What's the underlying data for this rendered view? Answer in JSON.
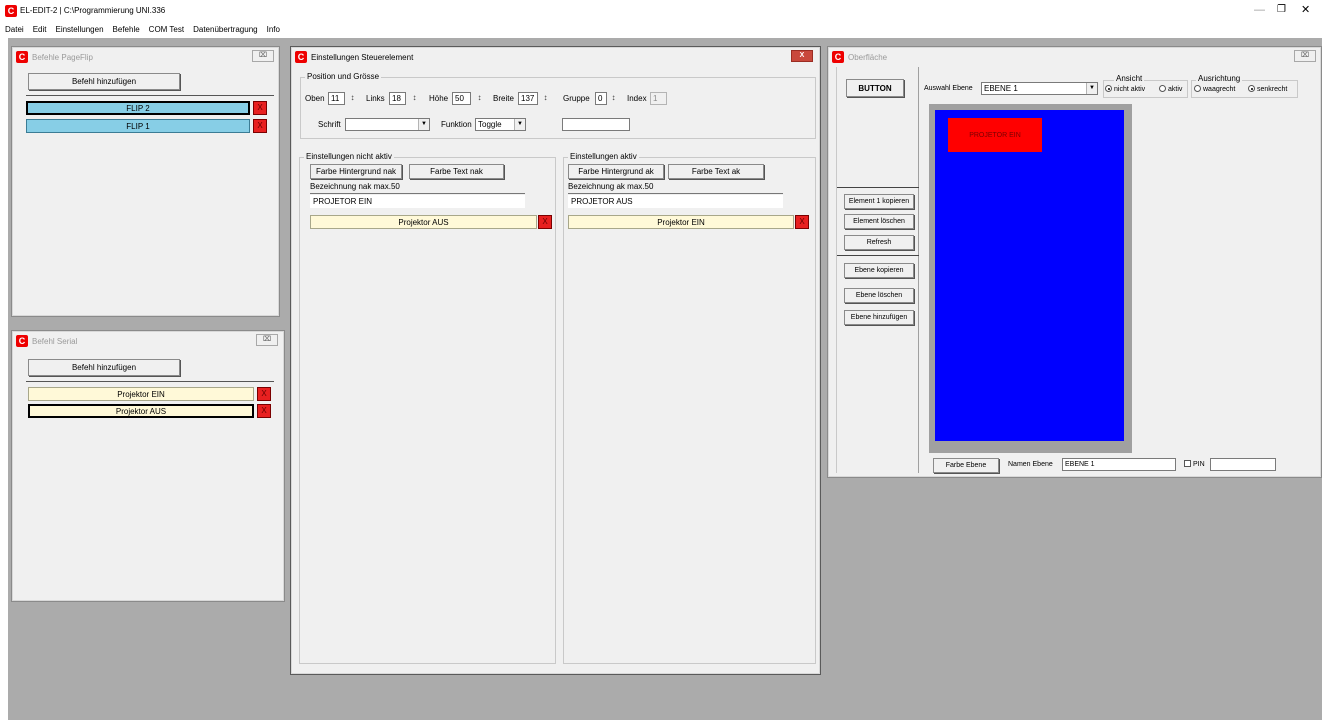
{
  "app": {
    "title": "EL-EDIT-2 | C:\\Programmierung UNI.336",
    "icon_letter": "C",
    "minimize": "—",
    "restore": "❐",
    "close": "✕"
  },
  "menu": [
    "Datei",
    "Edit",
    "Einstellungen",
    "Befehle",
    "COM Test",
    "Datenübertragung",
    "Info"
  ],
  "pageflip": {
    "title": "Befehle PageFlip",
    "close": "⌧",
    "add_label": "Befehl hinzufügen",
    "items": [
      {
        "label": "FLIP 2",
        "x": "X"
      },
      {
        "label": "FLIP 1",
        "x": "X"
      }
    ]
  },
  "serial": {
    "title": "Befehl Serial",
    "close": "⌧",
    "add_label": "Befehl hinzufügen",
    "items": [
      {
        "label": "Projektor EIN",
        "x": "X"
      },
      {
        "label": "Projektor AUS",
        "x": "X"
      }
    ]
  },
  "einstellungen": {
    "title": "Einstellungen Steuerelement",
    "close": "X",
    "position_group": "Position und Grösse",
    "oben_label": "Oben",
    "oben_value": "11",
    "links_label": "Links",
    "links_value": "18",
    "hoehe_label": "Höhe",
    "hoehe_value": "50",
    "breite_label": "Breite",
    "breite_value": "137",
    "gruppe_label": "Gruppe",
    "gruppe_value": "0",
    "index_label": "Index",
    "index_value": "1",
    "schrift_label": "Schrift",
    "schrift_value": "",
    "funktion_label": "Funktion",
    "funktion_value": "Toggle",
    "extra_value": "",
    "spin_glyph": "↕",
    "dd_arrow": "▼",
    "nak": {
      "group": "Einstellungen nicht aktiv",
      "bg_button": "Farbe Hintergrund nak",
      "text_button": "Farbe Text nak",
      "bez_label": "Bezeichnung nak max.50",
      "bez_value": "PROJETOR EIN",
      "cmd_label": "Projektor AUS",
      "x": "X"
    },
    "ak": {
      "group": "Einstellungen aktiv",
      "bg_button": "Farbe Hintergrund ak",
      "text_button": "Farbe Text ak",
      "bez_label": "Bezeichnung ak max.50",
      "bez_value": "PROJETOR AUS",
      "cmd_label": "Projektor EIN",
      "x": "X"
    }
  },
  "oberflaeche": {
    "title": "Oberfläche",
    "close": "⌧",
    "button_type": "BUTTON",
    "auswahl_label": "Auswahl Ebene",
    "auswahl_value": "EBENE 1",
    "ansicht_group": "Ansicht",
    "ansicht_nicht_aktiv": "nicht aktiv",
    "ansicht_aktiv": "aktiv",
    "ausrichtung_group": "Ausrichtung",
    "ausrichtung_waagrecht": "waagrecht",
    "ausrichtung_senkrecht": "senkrecht",
    "element_kopieren": "Element 1 kopieren",
    "element_loeschen": "Element löschen",
    "refresh": "Refresh",
    "ebene_kopieren": "Ebene kopieren",
    "ebene_loeschen": "Ebene löschen",
    "ebene_hinzufuegen": "Ebene hinzufügen",
    "canvas_element_label": "PROJETOR EIN",
    "farbe_ebene": "Farbe Ebene",
    "namen_ebene_label": "Namen Ebene",
    "namen_ebene_value": "EBENE 1",
    "pin_label": "PIN",
    "pin_value": "",
    "canvas_color": "#0000ff",
    "element_color": "#ff0000"
  }
}
